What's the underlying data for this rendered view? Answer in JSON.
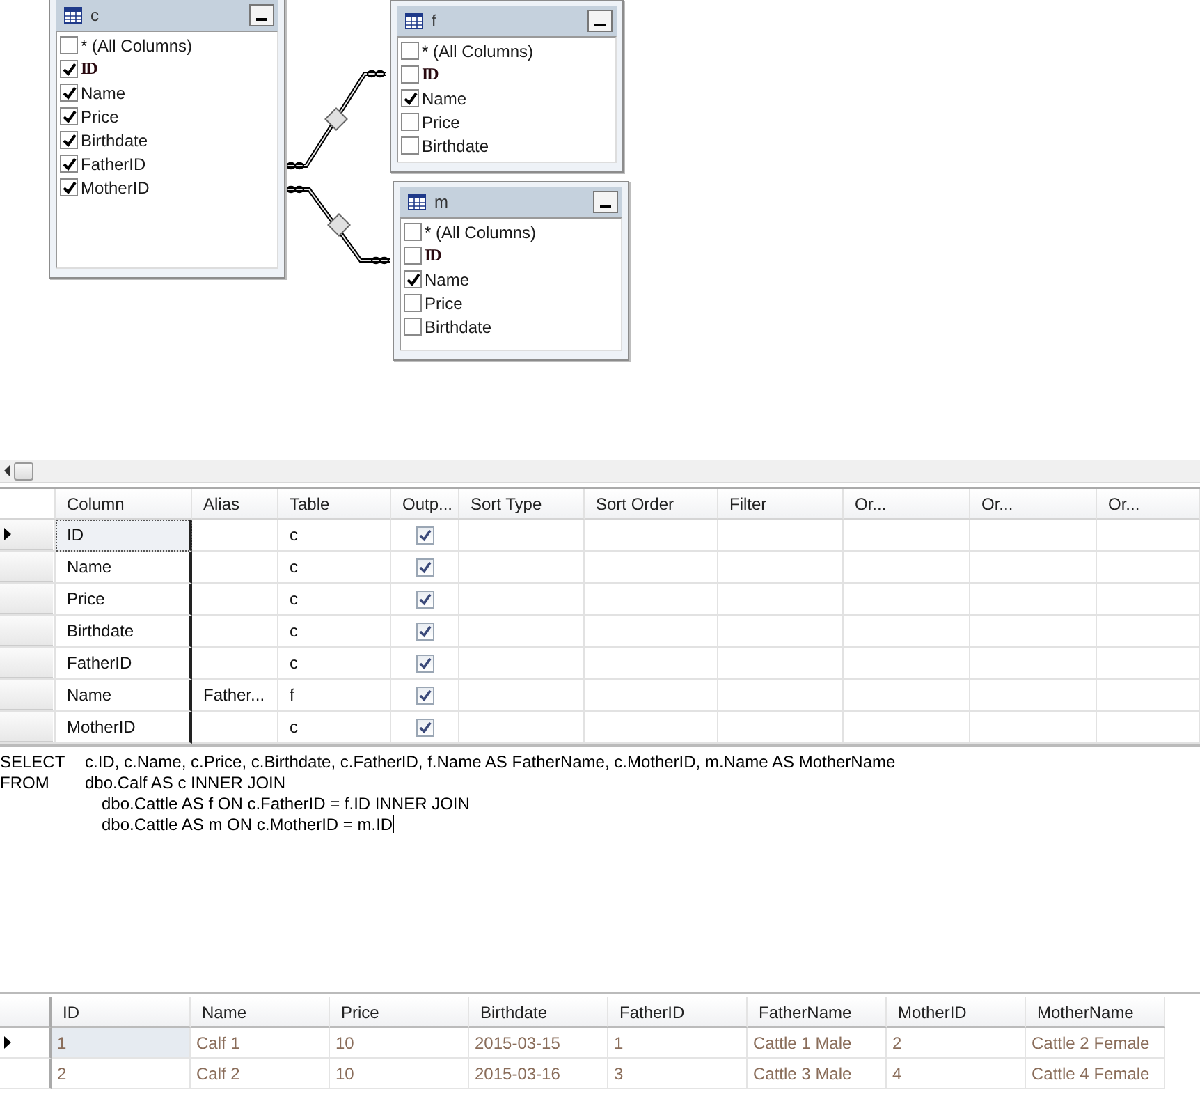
{
  "diagram": {
    "tables": [
      {
        "name": "c",
        "columns": [
          {
            "label": "* (All Columns)",
            "checked": false,
            "key": false
          },
          {
            "label": "ID",
            "checked": true,
            "key": true
          },
          {
            "label": "Name",
            "checked": true,
            "key": false
          },
          {
            "label": "Price",
            "checked": true,
            "key": false
          },
          {
            "label": "Birthdate",
            "checked": true,
            "key": false
          },
          {
            "label": "FatherID",
            "checked": true,
            "key": false
          },
          {
            "label": "MotherID",
            "checked": true,
            "key": false
          }
        ]
      },
      {
        "name": "f",
        "columns": [
          {
            "label": "* (All Columns)",
            "checked": false,
            "key": false
          },
          {
            "label": "ID",
            "checked": false,
            "key": true
          },
          {
            "label": "Name",
            "checked": true,
            "key": false
          },
          {
            "label": "Price",
            "checked": false,
            "key": false
          },
          {
            "label": "Birthdate",
            "checked": false,
            "key": false
          }
        ]
      },
      {
        "name": "m",
        "columns": [
          {
            "label": "* (All Columns)",
            "checked": false,
            "key": false
          },
          {
            "label": "ID",
            "checked": false,
            "key": true
          },
          {
            "label": "Name",
            "checked": true,
            "key": false
          },
          {
            "label": "Price",
            "checked": false,
            "key": false
          },
          {
            "label": "Birthdate",
            "checked": false,
            "key": false
          }
        ]
      }
    ]
  },
  "criteria_grid": {
    "columns": [
      "Column",
      "Alias",
      "Table",
      "Outp...",
      "Sort Type",
      "Sort Order",
      "Filter",
      "Or...",
      "Or...",
      "Or..."
    ],
    "rows": [
      {
        "column": "ID",
        "alias": "",
        "table": "c",
        "output": true,
        "selected": true
      },
      {
        "column": "Name",
        "alias": "",
        "table": "c",
        "output": true,
        "selected": false
      },
      {
        "column": "Price",
        "alias": "",
        "table": "c",
        "output": true,
        "selected": false
      },
      {
        "column": "Birthdate",
        "alias": "",
        "table": "c",
        "output": true,
        "selected": false
      },
      {
        "column": "FatherID",
        "alias": "",
        "table": "c",
        "output": true,
        "selected": false
      },
      {
        "column": "Name",
        "alias": "Father...",
        "table": "f",
        "output": true,
        "selected": false
      },
      {
        "column": "MotherID",
        "alias": "",
        "table": "c",
        "output": true,
        "selected": false
      }
    ]
  },
  "sql": {
    "lines": [
      {
        "kind": "clause",
        "keyword": "SELECT",
        "text": "c.ID, c.Name, c.Price, c.Birthdate, c.FatherID, f.Name AS FatherName, c.MotherID, m.Name AS MotherName"
      },
      {
        "kind": "clause",
        "keyword": "FROM",
        "text": "dbo.Calf AS c INNER JOIN"
      },
      {
        "kind": "continuation",
        "text": "dbo.Cattle AS f ON c.FatherID = f.ID INNER JOIN"
      },
      {
        "kind": "continuation",
        "text": "dbo.Cattle AS m ON c.MotherID = m.ID"
      }
    ]
  },
  "results": {
    "columns": [
      "ID",
      "Name",
      "Price",
      "Birthdate",
      "FatherID",
      "FatherName",
      "MotherID",
      "MotherName"
    ],
    "rows": [
      {
        "selected": true,
        "cells": [
          "1",
          "Calf 1",
          "10",
          "2015-03-15",
          "1",
          "Cattle 1 Male",
          "2",
          "Cattle 2 Female"
        ]
      },
      {
        "selected": false,
        "cells": [
          "2",
          "Calf 2",
          "10",
          "2015-03-16",
          "3",
          "Cattle 3 Male",
          "4",
          "Cattle 4 Female"
        ]
      }
    ]
  }
}
